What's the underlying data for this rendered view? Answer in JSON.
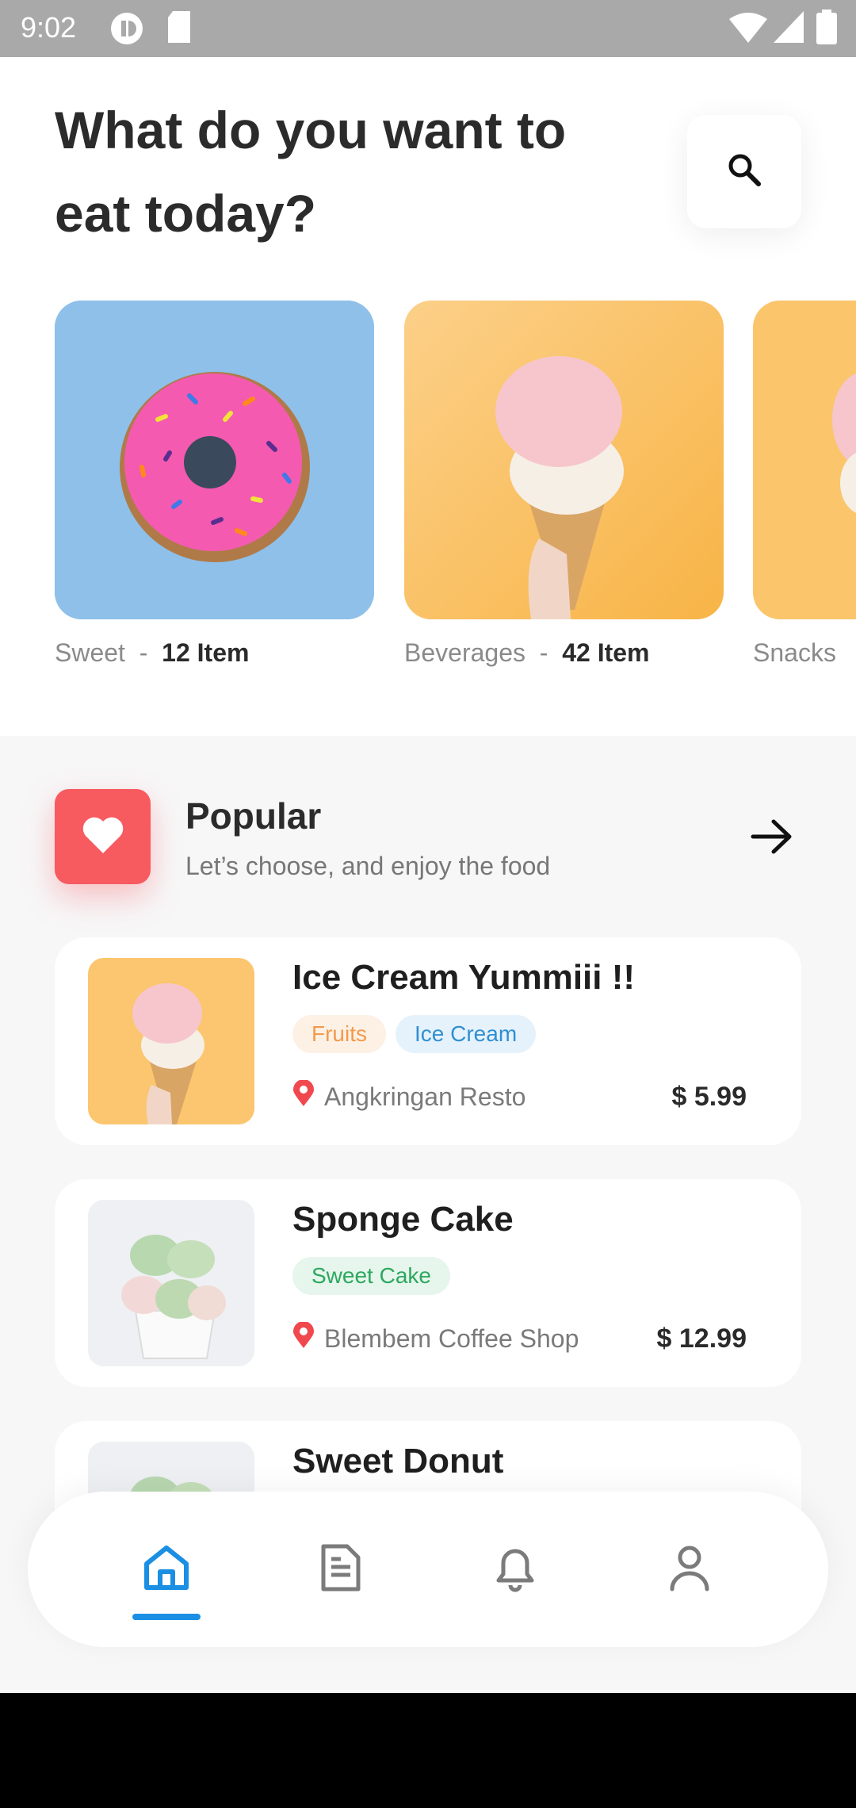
{
  "status_bar": {
    "time": "9:02"
  },
  "header": {
    "title": "What do you want to eat today?"
  },
  "categories": [
    {
      "name": "Sweet",
      "count": "12 Item"
    },
    {
      "name": "Beverages",
      "count": "42 Item"
    },
    {
      "name": "Snacks",
      "count": ""
    }
  ],
  "popular": {
    "title": "Popular",
    "subtitle": "Let’s choose, and enjoy the food"
  },
  "foods": [
    {
      "title": "Ice Cream Yummiii !!",
      "tags": [
        "Fruits",
        "Ice Cream"
      ],
      "location": "Angkringan Resto",
      "price": "$ 5.99"
    },
    {
      "title": "Sponge Cake",
      "tags": [
        "Sweet Cake"
      ],
      "location": "Blembem Coffee Shop",
      "price": "$ 12.99"
    },
    {
      "title": "Sweet Donut"
    }
  ],
  "nav": {
    "items": [
      "home-icon",
      "document-icon",
      "bell-icon",
      "user-icon"
    ],
    "active": "home-icon"
  },
  "colors": {
    "accent": "#1a8fe3",
    "heart": "#f75a5f",
    "price": "#2b2b2b"
  }
}
